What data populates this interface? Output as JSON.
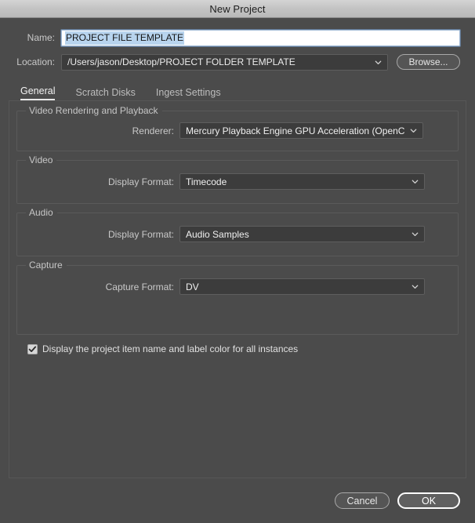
{
  "window": {
    "title": "New Project"
  },
  "fields": {
    "name_label": "Name:",
    "name_value": "PROJECT FILE TEMPLATE",
    "location_label": "Location:",
    "location_value": "/Users/jason/Desktop/PROJECT FOLDER TEMPLATE",
    "browse_label": "Browse..."
  },
  "tabs": [
    {
      "label": "General",
      "active": true
    },
    {
      "label": "Scratch Disks",
      "active": false
    },
    {
      "label": "Ingest Settings",
      "active": false
    }
  ],
  "groups": {
    "render": {
      "legend": "Video Rendering and Playback",
      "renderer_label": "Renderer:",
      "renderer_value": "Mercury Playback Engine GPU Acceleration (OpenCL)"
    },
    "video": {
      "legend": "Video",
      "display_format_label": "Display Format:",
      "display_format_value": "Timecode"
    },
    "audio": {
      "legend": "Audio",
      "display_format_label": "Display Format:",
      "display_format_value": "Audio Samples"
    },
    "capture": {
      "legend": "Capture",
      "capture_format_label": "Capture Format:",
      "capture_format_value": "DV"
    }
  },
  "checkbox": {
    "label": "Display the project item name and label color for all instances",
    "checked": true
  },
  "footer": {
    "cancel_label": "Cancel",
    "ok_label": "OK"
  },
  "colors": {
    "dialog_bg": "#4b4b4b",
    "titlebar_bg": "#c3c3c3",
    "field_bg": "#3c3c3c",
    "selection_highlight": "#b8d4ee",
    "default_button_border": "#fdfdfd"
  }
}
